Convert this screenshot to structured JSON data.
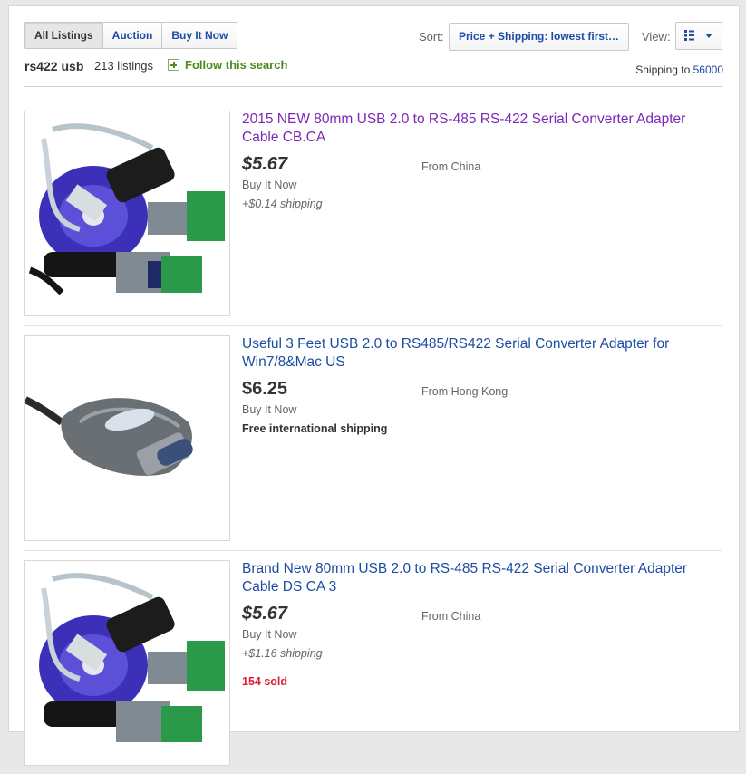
{
  "tabs": [
    {
      "label": "All Listings",
      "active": true
    },
    {
      "label": "Auction",
      "active": false
    },
    {
      "label": "Buy It Now",
      "active": false
    }
  ],
  "sort": {
    "label": "Sort:",
    "value": "Price + Shipping: lowest first…"
  },
  "view": {
    "label": "View:",
    "icon": "list-view-icon"
  },
  "search": {
    "query": "rs422 usb",
    "count": "213 listings",
    "follow_label": "Follow this search"
  },
  "shipping": {
    "label": "Shipping to",
    "zip": "56000"
  },
  "colors": {
    "link": "#1c4ca5",
    "visited": "#7b27b8",
    "sold": "#dd1e31",
    "follow": "#4e8a1d"
  },
  "listings": [
    {
      "title": "2015 NEW 80mm USB 2.0 to RS-485 RS-422 Serial Converter Adapter Cable CB.CA",
      "price": "$5.67",
      "format": "Buy It Now",
      "shipping": "+$0.14 shipping",
      "location": "From China",
      "sold": ""
    },
    {
      "title": "Useful 3 Feet USB 2.0 to RS485/RS422 Serial Converter Adapter for Win7/8&Mac US",
      "price": "$6.25",
      "format": "Buy It Now",
      "shipping": "Free international shipping",
      "location": "From Hong Kong",
      "sold": ""
    },
    {
      "title": "Brand New 80mm USB 2.0 to RS-485 RS-422 Serial Converter Adapter Cable DS CA 3",
      "price": "$5.67",
      "format": "Buy It Now",
      "shipping": "+$1.16 shipping",
      "location": "From China",
      "sold": "154 sold"
    }
  ]
}
